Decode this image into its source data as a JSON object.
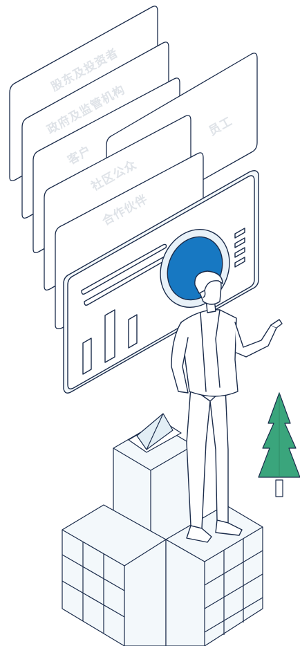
{
  "panels": [
    {
      "id": "shareholders",
      "label": "股东及投资者"
    },
    {
      "id": "government",
      "label": "政府及监管机构"
    },
    {
      "id": "customers",
      "label": "客户"
    },
    {
      "id": "employees",
      "label": "员工"
    },
    {
      "id": "community",
      "label": "社区公众"
    },
    {
      "id": "partners",
      "label": "合作伙伴"
    }
  ],
  "colors": {
    "line": "#1a2b4a",
    "panel_fill": "#ffffff",
    "label_text": "#dfe3e8",
    "accent_blue": "#1778c2",
    "accent_ring": "#e8f1f8",
    "tree_green": "#3aa57c",
    "building_fill": "#f3f8fb",
    "building_shade": "#e2eef5"
  },
  "icons": {
    "chart_board": "dashboard-board-icon",
    "person": "presenter-figure",
    "tree": "pine-tree-icon",
    "buildings": "isometric-buildings"
  }
}
